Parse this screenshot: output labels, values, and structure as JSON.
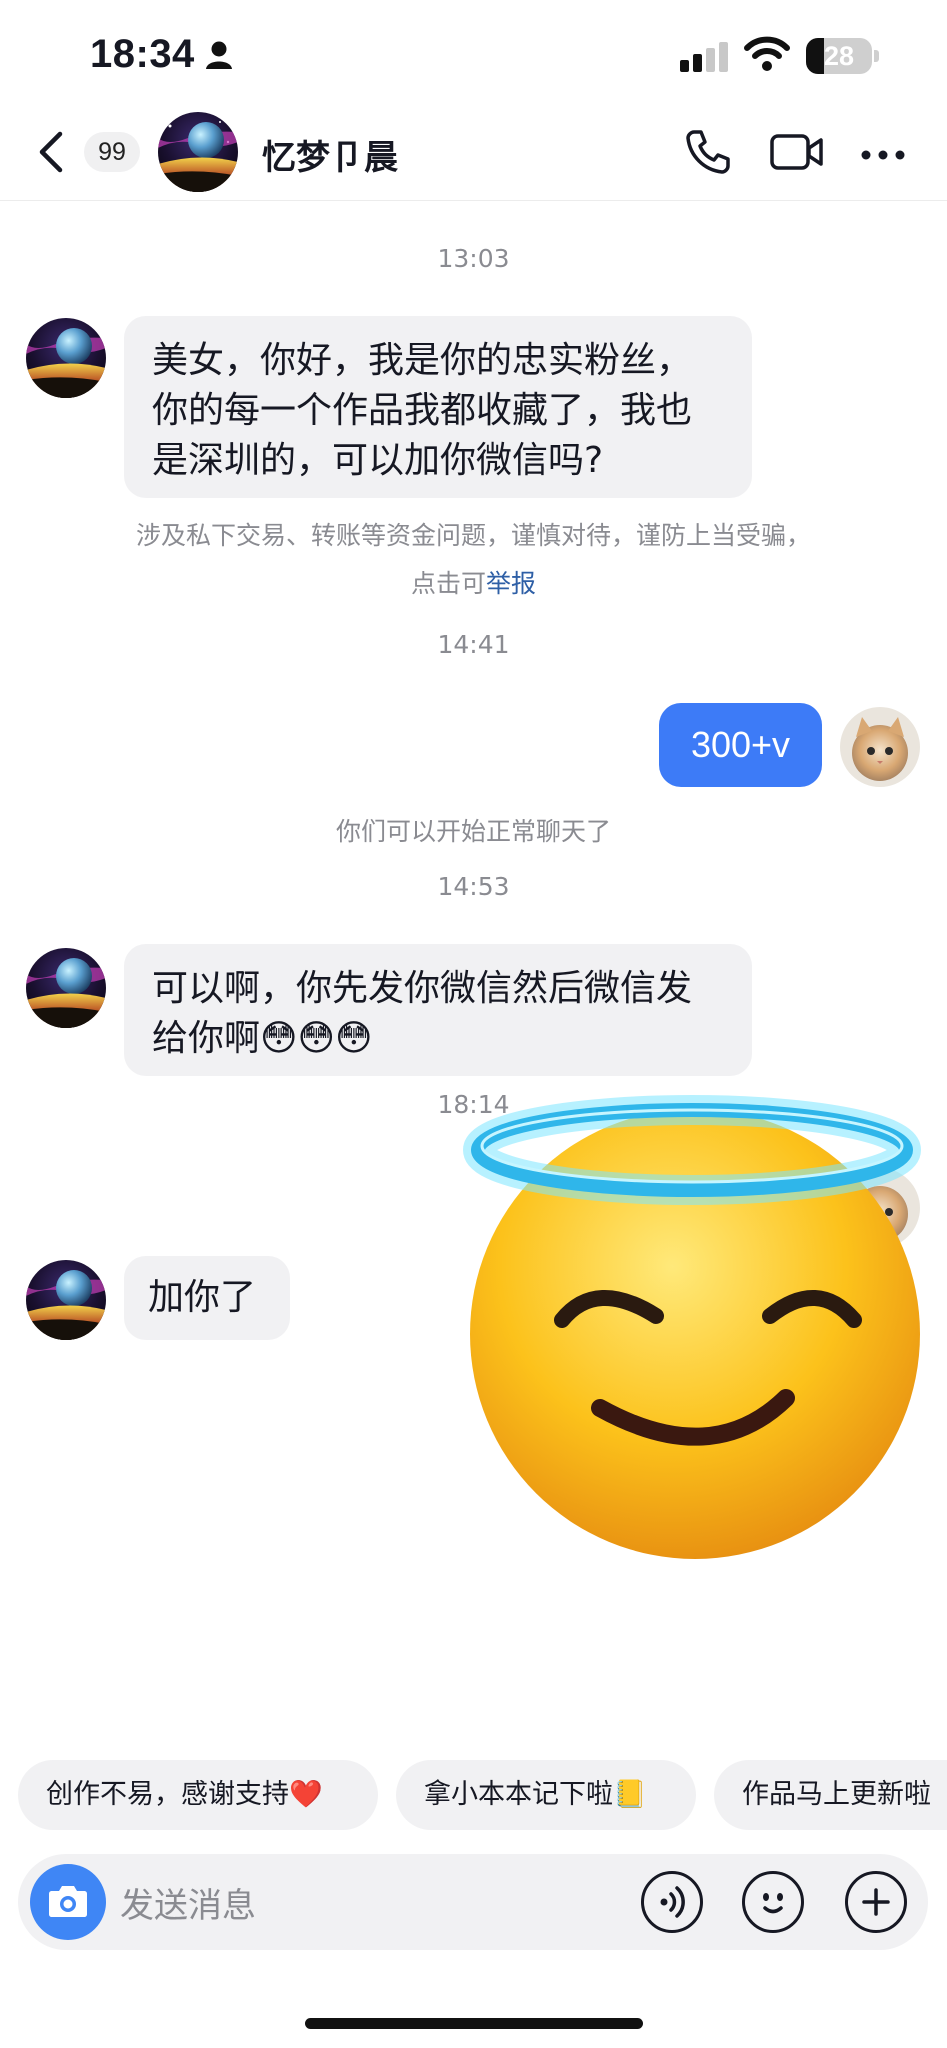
{
  "status_bar": {
    "time": "18:34",
    "battery": "28",
    "battery_level": 0.28
  },
  "header": {
    "unread_count": "99",
    "contact_name": "忆梦卩晨"
  },
  "messages": {
    "ts1": "13:03",
    "msg1": "美女，你好，我是你的忠实粉丝，你的每一个作品我都收藏了，我也是深圳的，可以加你微信吗?",
    "safety_text": "涉及私下交易、转账等资金问题，谨慎对待，谨防上当受骗，点击可",
    "safety_link": "举报",
    "ts2": "14:41",
    "msg2": "300+v",
    "system_note": "你们可以开始正常聊天了",
    "ts3": "14:53",
    "msg3": "可以啊，你先发你微信然后微信发给你啊😳😳😳",
    "ts4": "18:14",
    "msg4": "加你了"
  },
  "quick_replies": [
    "创作不易，感谢支持❤️",
    "拿小本本记下啦📒",
    "作品马上更新啦"
  ],
  "input": {
    "placeholder": "发送消息"
  },
  "colors": {
    "accent_blue": "#3d7bf7",
    "camera_blue": "#3f86f5",
    "link_blue": "#2e5fa6",
    "bubble_gray": "#f1f1f3"
  }
}
